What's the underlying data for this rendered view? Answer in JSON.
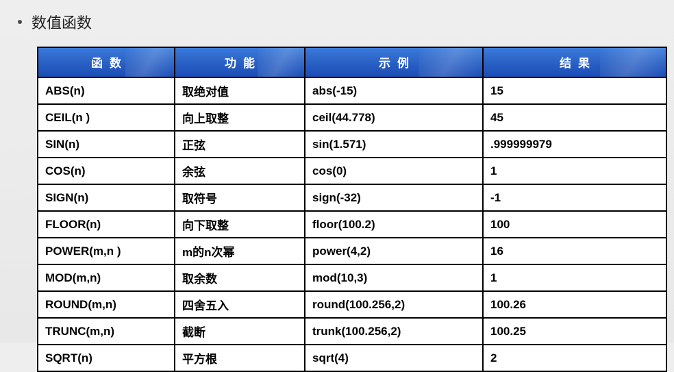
{
  "title": "数值函数",
  "headers": [
    "函数",
    "功能",
    "示例",
    "结果"
  ],
  "rows": [
    {
      "func": "ABS(n)",
      "desc": "取绝对值",
      "example": "abs(-15)",
      "result": "15"
    },
    {
      "func": "CEIL(n )",
      "desc": "向上取整",
      "example": "ceil(44.778)",
      "result": "45"
    },
    {
      "func": "SIN(n)",
      "desc": "正弦",
      "example": "sin(1.571)",
      "result": ".999999979"
    },
    {
      "func": "COS(n)",
      "desc": "余弦",
      "example": "cos(0)",
      "result": "1"
    },
    {
      "func": "SIGN(n)",
      "desc": "取符号",
      "example": "sign(-32)",
      "result": "-1"
    },
    {
      "func": "FLOOR(n)",
      "desc": "向下取整",
      "example": "floor(100.2)",
      "result": "100"
    },
    {
      "func": "POWER(m,n )",
      "desc": "m的n次幂",
      "example": "power(4,2)",
      "result": "16"
    },
    {
      "func": "MOD(m,n)",
      "desc": "取余数",
      "example": "mod(10,3)",
      "result": "1"
    },
    {
      "func": "ROUND(m,n)",
      "desc": "四舍五入",
      "example": "round(100.256,2)",
      "result": "100.26"
    },
    {
      "func": "TRUNC(m,n)",
      "desc": "截断",
      "example": "trunk(100.256,2)",
      "result": "100.25"
    },
    {
      "func": "SQRT(n)",
      "desc": "平方根",
      "example": "sqrt(4)",
      "result": "2"
    }
  ]
}
